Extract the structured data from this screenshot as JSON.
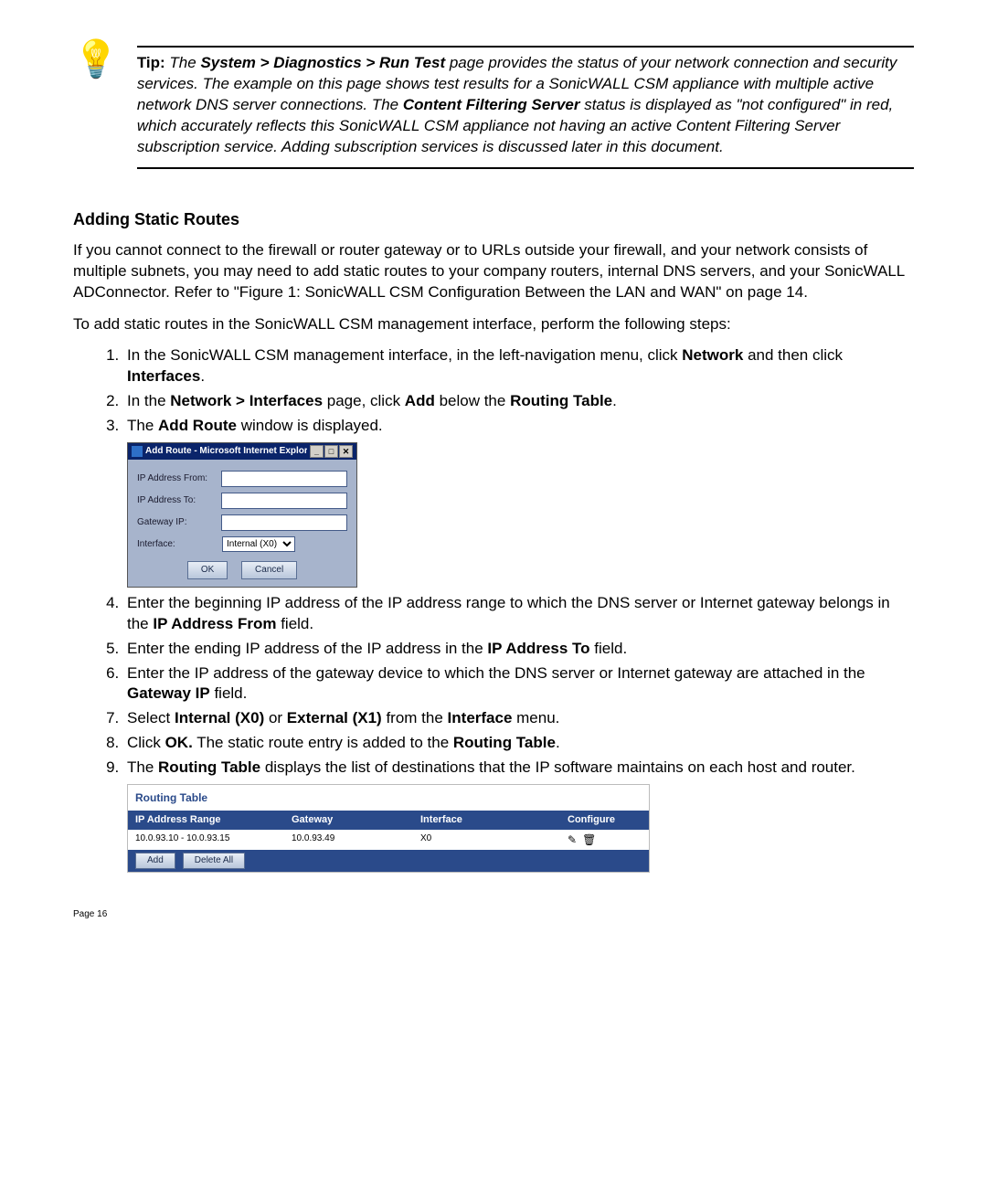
{
  "tip": {
    "label": "Tip:",
    "text_parts": {
      "p1": "The ",
      "b1": "System > Diagnostics > Run Test",
      "p2": " page provides the status of your network connection and security services. The example on this page shows test results for a SonicWALL CSM appliance with multiple active network DNS server connections. The ",
      "b2": "Content Filtering Server",
      "p3": " status is displayed as \"not configured\" in red, which accurately reflects this SonicWALL CSM appliance not having an active Content Filtering Server subscription service. Adding subscription services is discussed later in this document."
    }
  },
  "heading": "Adding Static Routes",
  "intro": "If you cannot connect to the firewall or router gateway or to URLs outside your firewall, and your network consists of multiple subnets, you may need to add static routes to your company routers, internal DNS servers, and your SonicWALL ADConnector. Refer to \"Figure 1: SonicWALL CSM Configuration Between the LAN and WAN\" on page 14.",
  "lead": "To add static routes in the SonicWALL CSM management interface, perform the following steps:",
  "steps": {
    "s1a": "In the SonicWALL CSM management interface, in the left-navigation menu, click ",
    "s1b1": "Network",
    "s1c": " and then click ",
    "s1b2": "Interfaces",
    "s1d": ".",
    "s2a": "In the ",
    "s2b1": "Network > Interfaces",
    "s2c": " page, click ",
    "s2b2": "Add",
    "s2d": " below the ",
    "s2b3": "Routing Table",
    "s2e": ".",
    "s3a": "The ",
    "s3b": "Add Route",
    "s3c": " window is displayed.",
    "s4a": "Enter the beginning IP address of the IP address range to which the DNS server or Internet gateway belongs in the ",
    "s4b": "IP Address From",
    "s4c": " field.",
    "s5a": "Enter the ending IP address of the IP address in the ",
    "s5b": "IP Address To",
    "s5c": " field.",
    "s6a": "Enter the IP address of the gateway device to which the DNS server or Internet gateway are attached in the ",
    "s6b": "Gateway IP",
    "s6c": " field.",
    "s7a": "Select ",
    "s7b1": "Internal (X0)",
    "s7c": " or ",
    "s7b2": "External (X1)",
    "s7d": " from the ",
    "s7b3": "Interface",
    "s7e": " menu.",
    "s8a": "Click ",
    "s8b1": "OK.",
    "s8c": " The static route entry is added to the ",
    "s8b2": "Routing Table",
    "s8d": ".",
    "s9a": "The ",
    "s9b": "Routing Table",
    "s9c": " displays the list of destinations that the IP software maintains on each host and router."
  },
  "dialog": {
    "title": "Add Route - Microsoft Internet Explorer provide...",
    "labels": {
      "from": "IP Address From:",
      "to": "IP Address To:",
      "gw": "Gateway IP:",
      "iface": "Interface:"
    },
    "iface_value": "Internal (X0)",
    "ok": "OK",
    "cancel": "Cancel"
  },
  "rtable": {
    "title": "Routing Table",
    "headers": {
      "range": "IP Address Range",
      "gw": "Gateway",
      "iface": "Interface",
      "conf": "Configure"
    },
    "row": {
      "range": "10.0.93.10 - 10.0.93.15",
      "gw": "10.0.93.49",
      "iface": "X0"
    },
    "add": "Add",
    "delete": "Delete All"
  },
  "page": "Page 16"
}
